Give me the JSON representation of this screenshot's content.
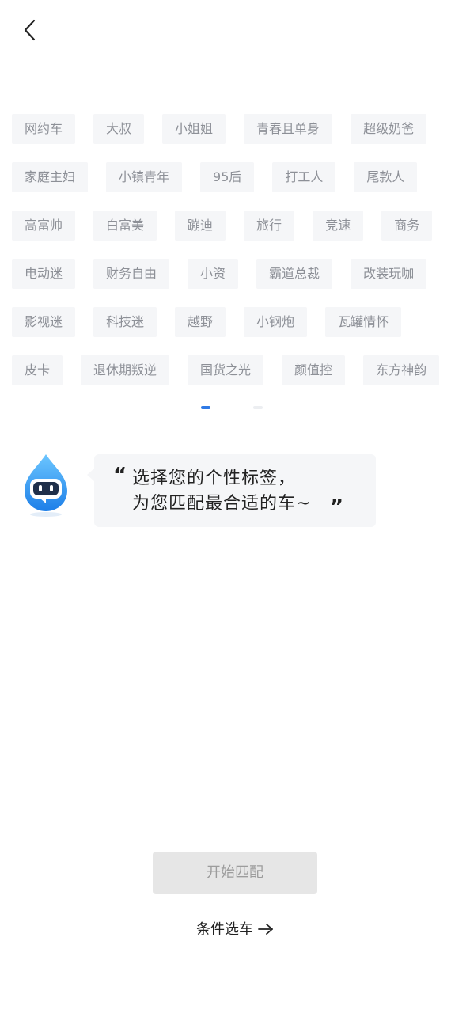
{
  "tag_rows": [
    [
      "网约车",
      "大叔",
      "小姐姐",
      "青春且单身",
      "超级奶爸"
    ],
    [
      "家庭主妇",
      "小镇青年",
      "95后",
      "打工人",
      "尾款人"
    ],
    [
      "高富帅",
      "白富美",
      "蹦迪",
      "旅行",
      "竞速",
      "商务"
    ],
    [
      "电动迷",
      "财务自由",
      "小资",
      "霸道总裁",
      "改装玩咖"
    ],
    [
      "影视迷",
      "科技迷",
      "越野",
      "小钢炮",
      "瓦罐情怀"
    ],
    [
      "皮卡",
      "退休期叛逆",
      "国货之光",
      "颜值控",
      "东方神韵"
    ]
  ],
  "bubble": {
    "quote_open": "“",
    "line1": "选择您的个性标签，",
    "line2": "为您匹配最合适的车~",
    "quote_close": "”"
  },
  "start_button": "开始匹配",
  "filter_link": "条件选车",
  "icons": {
    "back": "chevron-left-icon",
    "mascot": "robot-water-drop-icon",
    "arrow": "arrow-right-icon"
  },
  "colors": {
    "accent": "#2f7ae5",
    "tag_bg": "#f5f6f8",
    "tag_text": "#8d9097",
    "button_disabled_bg": "#e6e6e6",
    "button_disabled_text": "#9c9c9c"
  }
}
